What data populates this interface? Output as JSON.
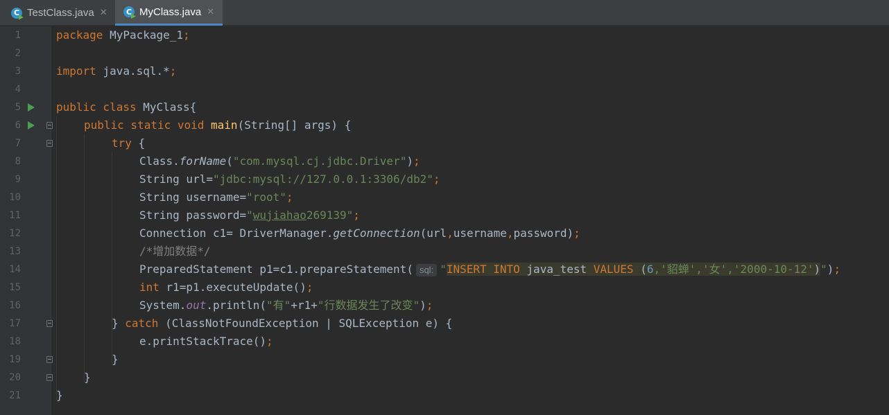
{
  "tabs": [
    {
      "label": "TestClass.java",
      "active": false,
      "icon": "java-class-icon"
    },
    {
      "label": "MyClass.java",
      "active": true,
      "icon": "java-class-icon"
    }
  ],
  "code": {
    "l1": {
      "num": "1",
      "kw": "package ",
      "rest": "MyPackage_1",
      "semi": ";"
    },
    "l2": {
      "num": "2"
    },
    "l3": {
      "num": "3",
      "kw": "import ",
      "rest": "java.sql.*",
      "semi": ";"
    },
    "l4": {
      "num": "4"
    },
    "l5": {
      "num": "5",
      "kw": "public class ",
      "rest": "MyClass{"
    },
    "l6": {
      "num": "6",
      "kw": "public static void ",
      "fn": "main",
      "rest": "(String[] args) {"
    },
    "l7": {
      "num": "7",
      "kw": "try ",
      "rest": "{"
    },
    "l8": {
      "num": "8",
      "a": "Class.",
      "b": "forName",
      "c": "(",
      "s": "\"com.mysql.cj.jdbc.Driver\"",
      "d": ")",
      "semi": ";"
    },
    "l9": {
      "num": "9",
      "a": "String url=",
      "s": "\"jdbc:mysql://127.0.0.1:3306/db2\"",
      "semi": ";"
    },
    "l10": {
      "num": "10",
      "a": "String username=",
      "s": "\"root\"",
      "semi": ";"
    },
    "l11": {
      "num": "11",
      "a": "String password=",
      "q": "\"",
      "t": "wujiahao",
      "s": "269139\"",
      "semi": ";"
    },
    "l12": {
      "num": "12",
      "a": "Connection c1= DriverManager.",
      "b": "getConnection",
      "c": "(url",
      "cm1": ",",
      "d": "username",
      "cm2": ",",
      "e": "password)",
      "semi": ";"
    },
    "l13": {
      "num": "13",
      "cmt": "/*增加数据*/"
    },
    "l14": {
      "num": "14",
      "a": "PreparedStatement p1=c1.prepareStatement(",
      "hint": "sql:",
      "q": "\"",
      "k1": "INSERT INTO ",
      "t1": "java_test ",
      "k2": "VALUES ",
      "p": "(",
      "n": "6",
      "s1": ",'貂蝉'",
      "s2": ",'女'",
      "s3": ",'2000-10-12'",
      "p2": ")",
      "q2": "\"",
      "e": ")",
      "semi": ";"
    },
    "l15": {
      "num": "15",
      "kw": "int ",
      "a": "r1=p1.executeUpdate()",
      "semi": ";"
    },
    "l16": {
      "num": "16",
      "a": "System.",
      "f": "out",
      "b": ".println(",
      "s1": "\"有\"",
      "c": "+r1+",
      "s2": "\"行数据发生了改变\"",
      "d": ")",
      "semi": ";"
    },
    "l17": {
      "num": "17",
      "a": "} ",
      "kw": "catch ",
      "b": "(ClassNotFoundException | SQLException e) {"
    },
    "l18": {
      "num": "18",
      "a": "e.printStackTrace()",
      "semi": ";"
    },
    "l19": {
      "num": "19",
      "a": "}"
    },
    "l20": {
      "num": "20",
      "a": "}"
    },
    "l21": {
      "num": "21",
      "a": "}"
    }
  }
}
